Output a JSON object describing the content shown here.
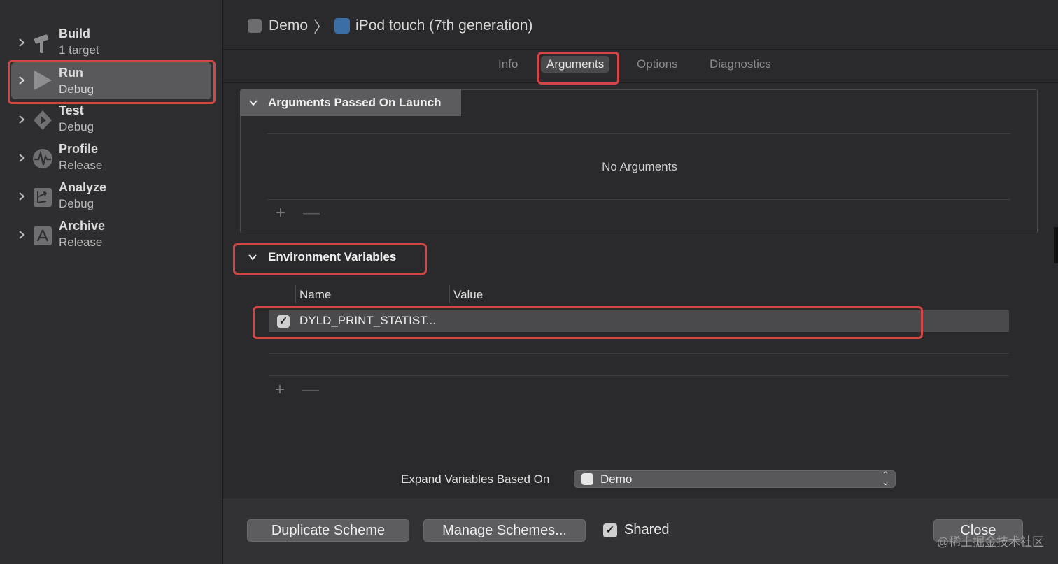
{
  "sidebar": {
    "items": [
      {
        "title": "Build",
        "subtitle": "1 target",
        "icon": "hammer-icon"
      },
      {
        "title": "Run",
        "subtitle": "Debug",
        "icon": "play-icon"
      },
      {
        "title": "Test",
        "subtitle": "Debug",
        "icon": "diamond-play-icon"
      },
      {
        "title": "Profile",
        "subtitle": "Release",
        "icon": "waveform-icon"
      },
      {
        "title": "Analyze",
        "subtitle": "Debug",
        "icon": "analyze-icon"
      },
      {
        "title": "Archive",
        "subtitle": "Release",
        "icon": "archive-icon"
      }
    ],
    "selected": "Run"
  },
  "breadcrumb": {
    "scheme": "Demo",
    "device": "iPod touch (7th generation)"
  },
  "tabs": [
    {
      "label": "Info"
    },
    {
      "label": "Arguments"
    },
    {
      "label": "Options"
    },
    {
      "label": "Diagnostics"
    }
  ],
  "active_tab": "Arguments",
  "arguments_section": {
    "title": "Arguments Passed On Launch",
    "empty_text": "No Arguments",
    "add_label": "+",
    "remove_label": "—"
  },
  "env_section": {
    "title": "Environment Variables",
    "col_name": "Name",
    "col_value": "Value",
    "rows": [
      {
        "checked": true,
        "name": "DYLD_PRINT_STATIST...",
        "value": ""
      }
    ],
    "add_label": "+",
    "remove_label": "—"
  },
  "expand": {
    "label": "Expand Variables Based On",
    "value": "Demo",
    "arrows": "⌃⌄"
  },
  "footer": {
    "duplicate": "Duplicate Scheme",
    "manage": "Manage Schemes...",
    "shared_label": "Shared",
    "shared_checked": true,
    "close": "Close",
    "watermark": "@稀土掘金技术社区"
  },
  "colors": {
    "highlight": "#d64545",
    "selected_bg": "#59595c"
  }
}
